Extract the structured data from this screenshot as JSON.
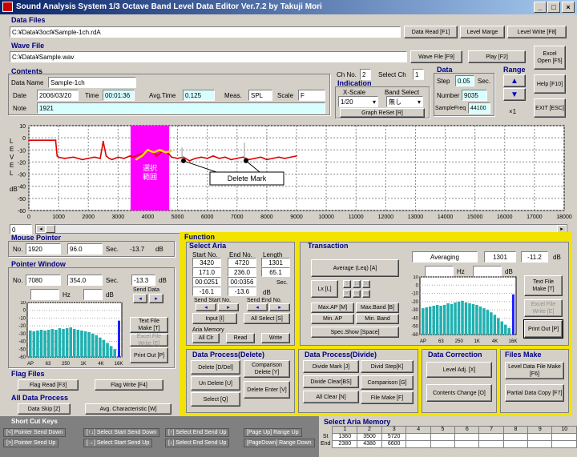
{
  "window": {
    "title": "Sound Analysis System  1/3 Octave Band Level Data Editor   Ver.7.2    by Takuji Mori"
  },
  "data_files": {
    "title": "Data Files",
    "path": "C:¥Data¥3oct¥Sample-1ch.rdA",
    "read": "Data Read [F1]",
    "merge": "Level Marge",
    "write": "Level Write [F8]"
  },
  "wave_file": {
    "title": "Wave File",
    "path": "C:¥Data¥Sample.wav",
    "file_btn": "Wave File [F9]",
    "play": "Play [F2]"
  },
  "side_buttons": {
    "excel": "Excel Open [F5]",
    "help": "Help [F10]",
    "exit": "EXIT [ESC]"
  },
  "contents": {
    "title": "Contents",
    "data_name_label": "Data Name",
    "data_name": "Sample-1ch",
    "date_label": "Date",
    "date": "2006/03/20",
    "time_label": "Time",
    "time": "00:01:36",
    "avg_label": "Avg.Time",
    "avg": "0.125",
    "meas_label": "Meas.",
    "meas": "SPL",
    "scale_label": "Scale",
    "scale": "F",
    "note_label": "Note",
    "note": "1921"
  },
  "channel": {
    "ch_no_label": "Ch No.",
    "ch_no": "2",
    "select_ch_label": "Select Ch",
    "select_ch": "1"
  },
  "indication": {
    "title": "Indication",
    "xscale_label": "X-Scale",
    "xscale": "1/20",
    "band_label": "Band Select",
    "band": "無し",
    "reset": "Graph ReSet  [R]"
  },
  "data_box": {
    "title": "Data",
    "step_label": "Step",
    "step": "0.05",
    "step_unit": "Sec.",
    "number_label": "Number",
    "number": "9035",
    "freq_label": "SampleFreq",
    "freq": "44100"
  },
  "range": {
    "title": "Range",
    "mult": "×1"
  },
  "graph": {
    "ylabel": "L\nE\nV\nE\nL\n\ndB",
    "yticks": [
      "10",
      "0",
      "-10",
      "-20",
      "-30",
      "-40",
      "-50",
      "-60"
    ],
    "xticks": [
      "0",
      "1000",
      "2000",
      "3000",
      "4000",
      "5000",
      "6000",
      "7000",
      "8000",
      "9000",
      "10000",
      "11000",
      "12000",
      "13000",
      "14000",
      "15000",
      "16000",
      "17000",
      "18000"
    ],
    "sel_label": "選択\n範囲",
    "delete_mark": "Delete Mark",
    "scroll_value": "0"
  },
  "chart_data": {
    "type": "line",
    "xlim": [
      0,
      18000
    ],
    "ylim": [
      -60,
      10
    ],
    "series": [
      {
        "x": [
          0,
          900,
          950,
          1000,
          1200,
          1500,
          1800,
          2000,
          2200,
          2400,
          2500,
          2600,
          2700,
          2800,
          3000,
          3200,
          3400,
          3500,
          3700,
          3900,
          4100,
          4300,
          4500,
          4700,
          4800,
          5000,
          5200,
          5400,
          5600,
          5800,
          6000,
          6200,
          6400,
          6600,
          6800,
          7000,
          7200,
          7400,
          7600,
          7800,
          8000,
          8200,
          8400,
          8600,
          8800,
          9000
        ],
        "y": [
          -2,
          -2,
          -15,
          -16,
          -17,
          -16,
          -18,
          -17,
          -16,
          -17,
          -3,
          -15,
          -17,
          -18,
          -16,
          -17,
          -15,
          -16,
          -14,
          -12,
          -10,
          -15,
          -11,
          -13,
          -16,
          -17,
          -16,
          -19,
          -17,
          -16,
          -17,
          -15,
          -17,
          -16,
          -18,
          -17,
          -16,
          -18,
          -17,
          -16,
          -18,
          -17,
          -16,
          -17,
          -16,
          -15
        ]
      },
      {
        "x": [
          3600,
          3800,
          4000,
          4200,
          4400,
          4600,
          4800
        ],
        "y": [
          -18,
          -15,
          -10,
          -12,
          -10,
          -12,
          -11
        ]
      }
    ]
  },
  "mouse_pointer": {
    "title": "Mouse Pointer",
    "no_label": "No.",
    "no": "1920",
    "sec_val": "96.0",
    "sec_label": "Sec.",
    "db_val": "-13.7",
    "db_label": "dB"
  },
  "pointer_window": {
    "title": "Pointer Window",
    "no_label": "No.",
    "no": "7080",
    "sec_val": "354.0",
    "sec_label": "Sec.",
    "db_val": "-13.3",
    "db_label": "dB",
    "hz_label": "Hz",
    "db2_label": "dB",
    "send_data": "Send Data",
    "text_file": "Text File Make [T]",
    "excel_file": "Excel File Write [E]",
    "print": "Print Out [P]",
    "xlabels": [
      "AP",
      "63",
      "250",
      "1K",
      "4K",
      "16K"
    ],
    "ylabels": [
      "10",
      "0",
      "-10",
      "-20",
      "-30",
      "-40",
      "-50",
      "-60"
    ]
  },
  "flag_files": {
    "title": "Flag Files",
    "read": "Flag Read  [F3]",
    "write": "Flag Write  [F4]"
  },
  "all_data": {
    "title": "All Data Process",
    "skip": "Data Skip [Z]",
    "avg": "Avg. Characteristic [W]"
  },
  "short_cut": {
    "title": "Short Cut Keys",
    "keys": [
      "[<] Pointer Send Down",
      "[↑↓] Select Start Send Down",
      "[↑] Select End Send Up",
      "[Page Up] Range Up",
      "[>] Pointer Send Up",
      "[→] Select Start Send Up",
      "[↓] Select End Send Up",
      "[PageDown] Range Down"
    ]
  },
  "function": {
    "title": "Function"
  },
  "select_aria": {
    "title": "Select Aria",
    "start_label": "Start No.",
    "end_label": "End No.",
    "length_label": "Length",
    "start": "3420",
    "end": "4720",
    "length": "1301",
    "start2": "171.0",
    "end2": "236.0",
    "length2": "65.1",
    "start3": "00:0251",
    "end3": "00:0356",
    "sec_label": "Sec.",
    "start4": "-16.1",
    "end4": "-13.6",
    "db_label": "dB",
    "send_start": "Send Start No.",
    "send_end": "Send End No.",
    "input": "Input  [I]",
    "all_select": "All Select [S]",
    "memory": "Aria Memory",
    "all_clr": "All Clr",
    "read": "Read",
    "write": "Write"
  },
  "transaction": {
    "title": "Transaction",
    "avg_btn": "Average (Leq) [A]",
    "lx": "Lx [L]",
    "lx_vals": [
      "5",
      "10",
      "50",
      "90",
      "95",
      "99"
    ],
    "max_ap": "Max.AP [M]",
    "max_band": "Max.Band [B]",
    "min_ap": "Min. AP",
    "min_band": "Min. Band",
    "spec": "Spec.Show [Space]",
    "mode": "Averaging",
    "count": "1301",
    "level": "-11.2",
    "db_label": "dB",
    "hz_label": "Hz",
    "db2_label": "dB",
    "text_file": "Text File Make [T]",
    "excel_file": "Excel File Write [E]",
    "print": "Print Out [P]",
    "xlabels": [
      "AP",
      "63",
      "250",
      "1K",
      "4K",
      "16K"
    ],
    "ylabels": [
      "10",
      "0",
      "-10",
      "-20",
      "-30",
      "-40",
      "-50",
      "-60"
    ]
  },
  "data_delete": {
    "title": "Data Process(Delete)",
    "delete": "Delete [D/Del]",
    "comp_delete": "Comparison Delete [Y]",
    "undelete": "Un Delete [U]",
    "delete_enter": "Delete Enter [V]",
    "select": "Select [Q]"
  },
  "data_divide": {
    "title": "Data Process(Divide)",
    "divide_mark": "Divide Mark [J]",
    "divid_step": "Divid Step[K]",
    "divide_clear": "Divide Clear[BS]",
    "comparison": "Comparison [G]",
    "all_clear": "All Clear [N]",
    "file_make": "File Make [F]"
  },
  "data_correction": {
    "title": "Data Correction",
    "level_adj": "Level Adj. [X]",
    "contents_change": "Contents Change [O]"
  },
  "files_make": {
    "title": "Files Make",
    "level_data": "Level Data File Make [F6]",
    "partial": "Partial Data Copy [F7]"
  },
  "aria_memory": {
    "title": "Select Aria Memory",
    "headers": [
      "1",
      "2",
      "3",
      "4",
      "5",
      "6",
      "7",
      "8",
      "9",
      "10"
    ],
    "st_label": "St",
    "end_label": "End",
    "st": [
      "1360",
      "3500",
      "5720",
      "",
      "",
      "",
      "",
      "",
      "",
      ""
    ],
    "end": [
      "2380",
      "4380",
      "6600",
      "",
      "",
      "",
      "",
      "",
      "",
      ""
    ]
  }
}
